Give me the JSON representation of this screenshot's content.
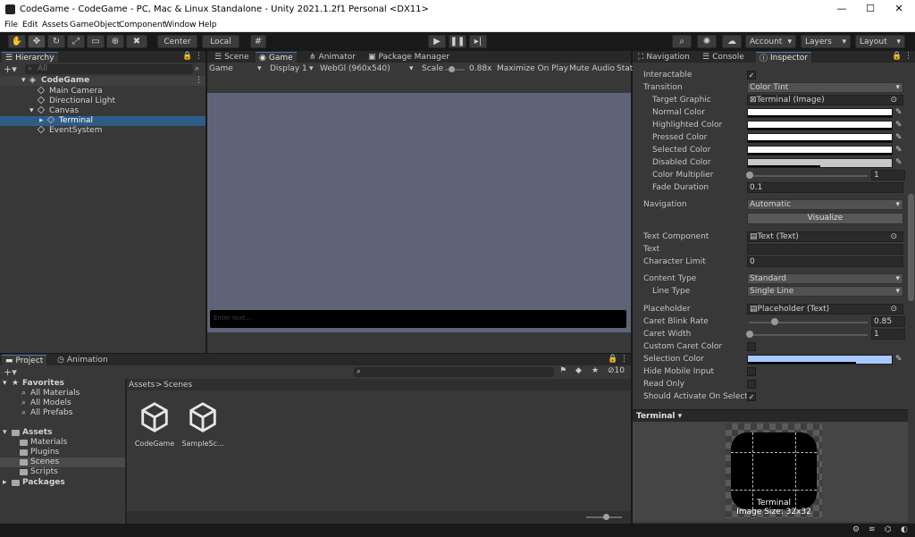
{
  "window": {
    "title": "CodeGame - CodeGame - PC, Mac & Linux Standalone - Unity 2021.1.2f1 Personal <DX11>",
    "controls": [
      "—",
      "☐",
      "✕"
    ]
  },
  "menu": [
    "File",
    "Edit",
    "Assets",
    "GameObject",
    "Component",
    "Window",
    "Help"
  ],
  "toolbar": {
    "pivot": "Center",
    "space": "Local",
    "account": "Account",
    "layers": "Layers",
    "layout": "Layout"
  },
  "hierarchy": {
    "tab": "Hierarchy",
    "search_placeholder": "All",
    "root": "CodeGame",
    "items": [
      {
        "label": "Main Camera"
      },
      {
        "label": "Directional Light"
      },
      {
        "label": "Canvas"
      },
      {
        "label": "Terminal"
      },
      {
        "label": "EventSystem"
      }
    ]
  },
  "center_tabs": [
    "Scene",
    "Game",
    "Animator",
    "Package Manager"
  ],
  "gamebar": {
    "mode": "Game",
    "display": "Display 1",
    "resolution": "WebGl (960x540)",
    "scale_label": "Scale",
    "scale_value": "0.88x",
    "scale_fraction": 0.3,
    "maximize": "Maximize On Play",
    "mute": "Mute Audio",
    "stats": "Stat"
  },
  "game_input_placeholder": "Enter text...",
  "right_tabs": [
    "Navigation",
    "Console",
    "Inspector"
  ],
  "inspector": {
    "rows": [
      {
        "label": "Interactable",
        "kind": "check",
        "checked": true
      },
      {
        "label": "Transition",
        "kind": "dropdown",
        "value": "Color Tint"
      },
      {
        "label": "Target Graphic",
        "kind": "object",
        "value": "Terminal (Image)"
      },
      {
        "label": "Normal Color",
        "kind": "color"
      },
      {
        "label": "Highlighted Color",
        "kind": "color"
      },
      {
        "label": "Pressed Color",
        "kind": "color"
      },
      {
        "label": "Selected Color",
        "kind": "color"
      },
      {
        "label": "Disabled Color",
        "kind": "color"
      },
      {
        "label": "Color Multiplier",
        "kind": "slider",
        "value": "1"
      },
      {
        "label": "Fade Duration",
        "kind": "text",
        "value": "0.1"
      },
      {
        "label": "Navigation",
        "kind": "dropdown",
        "value": "Automatic"
      },
      {
        "label": "Text Component",
        "kind": "object",
        "value": "Text (Text)"
      },
      {
        "label": "Text",
        "kind": "text",
        "value": ""
      },
      {
        "label": "Character Limit",
        "kind": "text",
        "value": "0"
      },
      {
        "label": "Content Type",
        "kind": "dropdown",
        "value": "Standard"
      },
      {
        "label": "Line Type",
        "kind": "dropdown",
        "value": "Single Line"
      },
      {
        "label": "Placeholder",
        "kind": "object",
        "value": "Placeholder (Text)"
      },
      {
        "label": "Caret Blink Rate",
        "kind": "slider",
        "value": "0.85"
      },
      {
        "label": "Caret Width",
        "kind": "slider",
        "value": "1"
      },
      {
        "label": "Custom Caret Color",
        "kind": "check",
        "checked": false
      },
      {
        "label": "Selection Color",
        "kind": "color"
      },
      {
        "label": "Hide Mobile Input",
        "kind": "check",
        "checked": false
      },
      {
        "label": "Read Only",
        "kind": "check",
        "checked": false
      },
      {
        "label": "Should Activate On Select",
        "kind": "check",
        "checked": true
      }
    ],
    "visualize": "Visualize",
    "preview_header": "Terminal",
    "preview_name": "Terminal",
    "preview_size": "Image Size: 32x32"
  },
  "project": {
    "tabs": [
      "Project",
      "Animation"
    ],
    "hidden_count": "10",
    "tree": [
      {
        "label": "Favorites"
      },
      {
        "label": "All Materials"
      },
      {
        "label": "All Models"
      },
      {
        "label": "All Prefabs"
      },
      {
        "label": "Assets"
      },
      {
        "label": "Materials"
      },
      {
        "label": "Plugins"
      },
      {
        "label": "Scenes"
      },
      {
        "label": "Scripts"
      },
      {
        "label": "Packages"
      }
    ],
    "breadcrumb": [
      "Assets",
      ">",
      "Scenes"
    ],
    "assets": [
      {
        "label": "CodeGame"
      },
      {
        "label": "SampleSc..."
      }
    ]
  },
  "colors": {
    "accent": "#3a79bb",
    "selection": "#2c5d87",
    "game_bg": "#5e6378",
    "selection_color": "#a8c8ff"
  }
}
